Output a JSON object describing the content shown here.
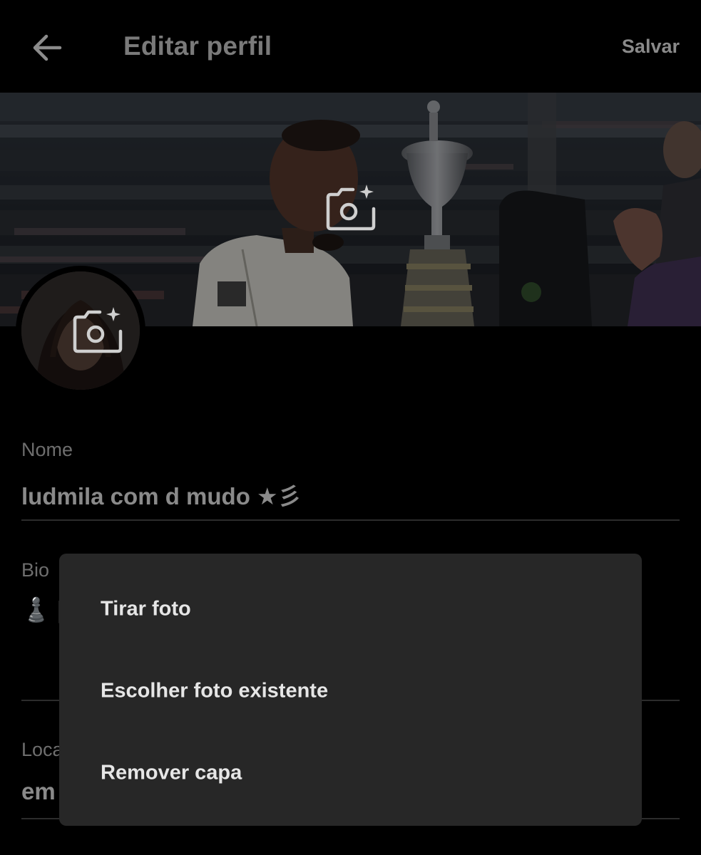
{
  "header": {
    "back_icon": "arrow-left-icon",
    "title": "Editar perfil",
    "save_label": "Salvar"
  },
  "banner": {
    "camera_icon": "camera-plus-icon"
  },
  "avatar": {
    "camera_icon": "camera-plus-icon"
  },
  "form": {
    "name": {
      "label": "Nome",
      "value": "ludmila com d mudo ★彡"
    },
    "bio": {
      "label": "Bio",
      "value": "♟️ |"
    },
    "location": {
      "label": "Loca",
      "value": "em"
    }
  },
  "menu": {
    "items": [
      {
        "label": "Tirar foto"
      },
      {
        "label": "Escolher foto existente"
      },
      {
        "label": "Remover capa"
      }
    ]
  },
  "colors": {
    "background": "#000000",
    "menu_background": "#272727",
    "menu_text": "#e6e6e6",
    "dimmed_text": "#8a8a8a"
  }
}
